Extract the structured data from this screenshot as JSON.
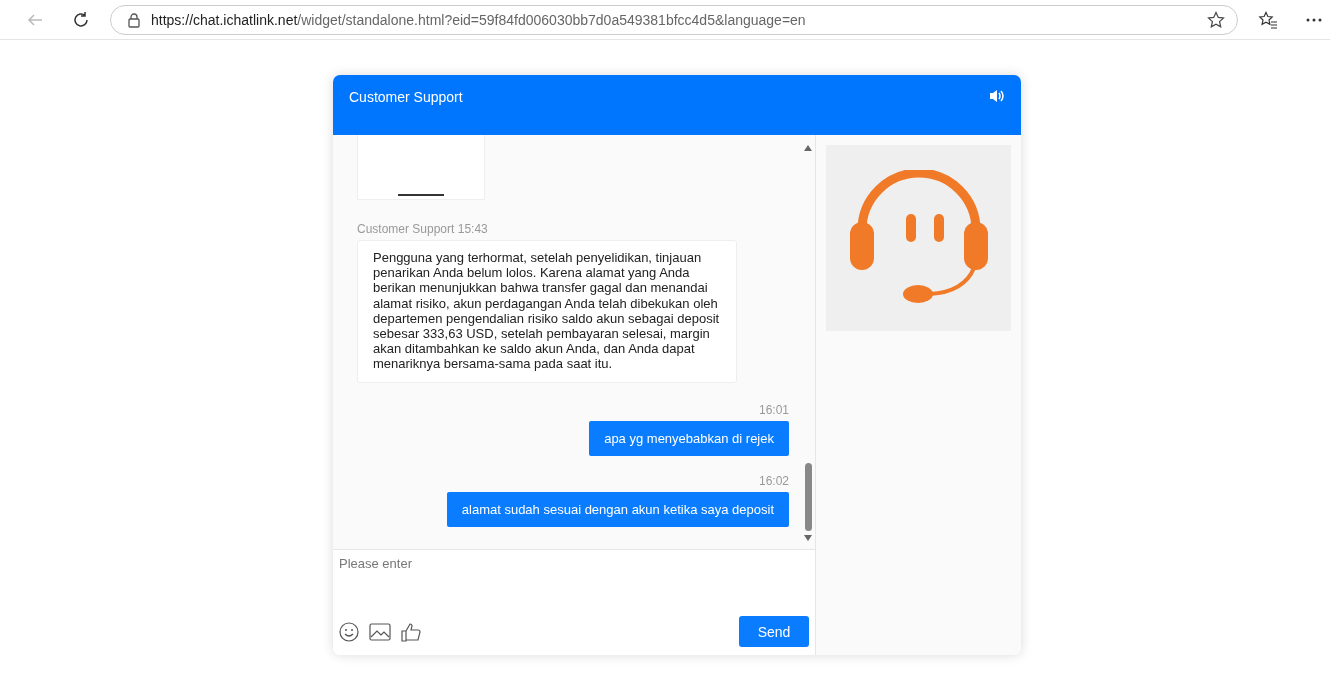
{
  "browser": {
    "url_host": "https://chat.ichatlink.net",
    "url_path": "/widget/standalone.html?eid=59f84fd006030bb7d0a549381bfcc4d5&language=en"
  },
  "chat": {
    "title": "Customer Support",
    "messages": [
      {
        "kind": "image"
      },
      {
        "kind": "agent",
        "meta": "Customer Support 15:43",
        "text": "Pengguna yang terhormat, setelah penyelidikan, tinjauan penarikan Anda belum lolos. Karena alamat yang Anda berikan menunjukkan bahwa transfer gagal dan menandai alamat risiko, akun perdagangan Anda telah dibekukan oleh departemen pengendalian risiko saldo akun sebagai deposit sebesar 333,63 USD, setelah pembayaran selesai, margin akan ditambahkan ke saldo akun Anda, dan Anda dapat menariknya bersama-sama pada saat itu."
      },
      {
        "kind": "user",
        "meta": "16:01",
        "text": "apa yg menyebabkan di rejek"
      },
      {
        "kind": "user",
        "meta": "16:02",
        "text": "alamat sudah sesuai dengan akun ketika saya deposit"
      }
    ],
    "input": {
      "placeholder": "Please enter"
    },
    "send_button": "Send"
  }
}
